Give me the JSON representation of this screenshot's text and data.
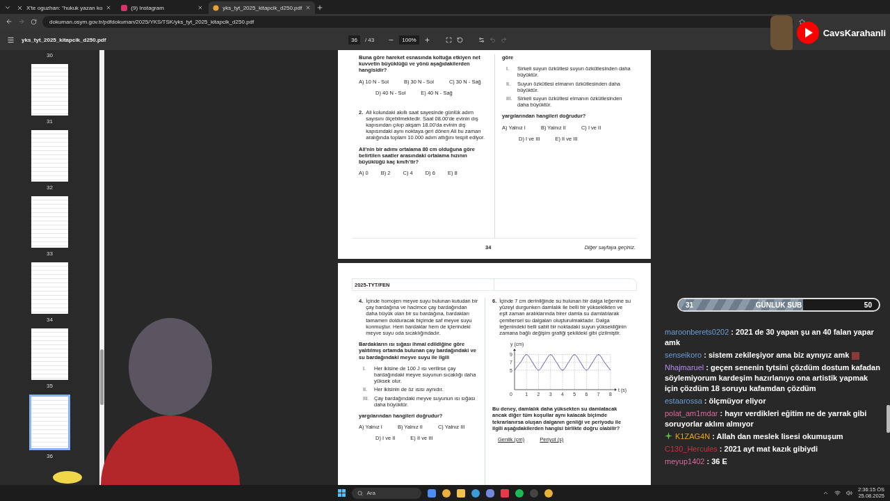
{
  "browser": {
    "tabs": [
      {
        "title": "X'te oguzhan: \"hukuk yazan ko",
        "kind": "x",
        "selected": false
      },
      {
        "title": "(9) Instagram",
        "kind": "instagram",
        "selected": false
      },
      {
        "title": "yks_tyt_2025_kitapcik_d250.pdf",
        "kind": "pdf",
        "selected": true
      }
    ],
    "url": "dokuman.osym.gov.tr/pdfdokuman/2025/YKS/TSK/yks_tyt_2025_kitapcik_d250.pdf"
  },
  "channel_logo": {
    "name": "CavsKarahanli"
  },
  "pdf_toolbar": {
    "title": "yks_tyt_2025_kitapcik_d250.pdf",
    "page": "36",
    "page_count": "/ 43",
    "zoom": "100%"
  },
  "thumbnails": {
    "top_label": "30",
    "items": [
      {
        "label": "31",
        "selected": false
      },
      {
        "label": "32",
        "selected": false
      },
      {
        "label": "33",
        "selected": false
      },
      {
        "label": "34",
        "selected": false
      },
      {
        "label": "35",
        "selected": false
      },
      {
        "label": "36",
        "selected": true
      }
    ]
  },
  "pages": [
    {
      "columns": [
        [
          {
            "kind": "bold",
            "text": "Buna göre hareket esnasında koltuğa etkiyen net kuvvetin büyüklüğü ve yönü aşağıdakilerden hangisidir?"
          },
          {
            "kind": "options",
            "rows": [
              [
                "A) 10 N - Sol",
                "B) 30 N - Sol",
                "C) 30 N - Sağ"
              ],
              [
                "D) 40 N - Sol",
                "E) 40 N - Sağ"
              ]
            ]
          },
          {
            "kind": "question",
            "number": "2.",
            "text": "Ali kolundaki akıllı saat sayesinde günlük adım sayısını ölçebilmektedir. Saat 08.00'de evinin dış kapısından çıkıp akşam 18.00'da evinin dış kapısındaki aynı noktaya geri dönen Ali bu zaman aralığında toplam 10.000 adım attığını tespit ediyor."
          },
          {
            "kind": "bold",
            "text": "Ali'nin bir adımı ortalama 80 cm olduğuna göre belirtilen saatler arasındaki ortalama hızının büyüklüğü kaç km/h'tir?"
          },
          {
            "kind": "options",
            "rows": [
              [
                "A) 0",
                "B) 2",
                "C) 4",
                "D) 6",
                "E) 8"
              ]
            ]
          }
        ],
        [
          {
            "kind": "bold",
            "text": "göre"
          },
          {
            "kind": "statements",
            "items": [
              {
                "numeral": "I.",
                "text": "Sirkeli suyun özkütlesi suyun özkütlesinden daha büyüktür."
              },
              {
                "numeral": "II.",
                "text": "Suyun özkütlesi elmanın özkütlesinden daha büyüktür."
              },
              {
                "numeral": "III.",
                "text": "Sirkeli suyun özkütlesi elmanın özkütlesinden daha büyüktür."
              }
            ]
          },
          {
            "kind": "bold",
            "text": "yargılarından hangileri doğrudur?"
          },
          {
            "kind": "options",
            "rows": [
              [
                "A) Yalnız I",
                "B) Yalnız II",
                "C) I ve II"
              ],
              [
                "D) I ve III",
                "E) II ve III"
              ]
            ]
          }
        ]
      ],
      "footer": {
        "page_number": "34",
        "note": "Diğer sayfaya geçiniz."
      }
    },
    {
      "header": "2025-TYT/FEN",
      "columns": [
        [
          {
            "kind": "question",
            "number": "4.",
            "text": "İçinde homojen meyve suyu bulunan kutudan bir çay bardağına ve hacimce çay bardağından daha büyük olan bir su bardağına, bardakları tamamen dolduracak biçimde saf meyve suyu konmuştur. Hem bardaklar hem de içlerindeki meyve suyu oda sıcaklığındadır."
          },
          {
            "kind": "bold",
            "text": "Bardakların ısı sığası ihmal edildiğine göre yalıtılmış ortamda bulunan çay bardağındaki ve su bardağındaki meyve suyu ile ilgili"
          },
          {
            "kind": "statements",
            "items": [
              {
                "numeral": "I.",
                "text": "Her ikisine de 100 J ısı verilirse çay bardağındaki meyve suyunun sıcaklığı daha yüksek olur."
              },
              {
                "numeral": "II.",
                "text": "Her ikisinin de öz ısısı aynıdır."
              },
              {
                "numeral": "III.",
                "text": "Çay bardağındaki meyve suyunun ısı sığası daha büyüktür."
              }
            ]
          },
          {
            "kind": "bold",
            "text": "yargılarından hangileri doğrudur?"
          },
          {
            "kind": "options",
            "rows": [
              [
                "A) Yalnız I",
                "B) Yalnız II",
                "C) Yalnız III"
              ],
              [
                "D) I ve II",
                "E) II ve III"
              ]
            ]
          }
        ],
        [
          {
            "kind": "question",
            "number": "6.",
            "text": "İçinde 7 cm derinliğinde su bulunan bir dalga leğenine su yüzeyi durgunken damlalık ile belli bir yükseklikten ve eşit zaman aralıklarında birer damla su damlatılarak çembersel su dalgaları oluşturulmaktadır. Dalga leğenindeki belli sabit bir noktadaki suyun yüksekliğinin zamana bağlı değişim grafiği şekildeki gibi çizilmiştir."
          },
          {
            "kind": "chart",
            "chart_data": {
              "type": "line",
              "xlabel": "t (s)",
              "ylabel": "y (cm)",
              "x": [
                0,
                0.5,
                1,
                1.5,
                2,
                2.5,
                3,
                3.5,
                4,
                4.5,
                5,
                5.5,
                6,
                6.5,
                7,
                7.5,
                8
              ],
              "series": [
                {
                  "color": "#5b4ea0",
                  "values": [
                    5,
                    7,
                    9,
                    7,
                    5,
                    7,
                    9,
                    7,
                    5,
                    7,
                    9,
                    7,
                    5,
                    7,
                    9,
                    7,
                    5
                  ]
                }
              ],
              "xlim": [
                0,
                8
              ],
              "ylim": [
                0,
                10
              ],
              "xticks": [
                0,
                1,
                2,
                3,
                4,
                5,
                6,
                7,
                8
              ],
              "yticks": [
                5,
                7,
                9
              ],
              "grid": true
            }
          },
          {
            "kind": "bold",
            "text": "Bu deney, damlalık daha yüksekten su damlatacak ancak diğer tüm koşullar aynı kalacak biçimde tekrarlanırsa oluşan dalganın genliği ve periyodu ile ilgili aşağıdakilerden hangisi birlikte doğru olabilir?"
          },
          {
            "kind": "table_head",
            "cells": [
              "Genlik (cm)",
              "Periyot (s)"
            ]
          }
        ]
      ]
    }
  ],
  "goal_bar": {
    "start": "31",
    "label": "GÜNLUK SUB",
    "end": "50",
    "level": 0.62
  },
  "chat": [
    {
      "user": "maroonberets0202",
      "color": "#6a9fd8",
      "badge": false,
      "emote": false,
      "text": ": 2021 de 30 yapan şu an 40 falan yapar amk"
    },
    {
      "user": "senseikoro",
      "color": "#6a9fd8",
      "badge": false,
      "emote": true,
      "text": ": sistem zekileşiyor ama biz aynıyız amk"
    },
    {
      "user": "Nhajmaruel",
      "color": "#b68cf0",
      "badge": false,
      "emote": false,
      "text": ": geçen senenin tytsini çözdüm dostum kafadan söylemiyorum kardeşim hazırlanıyo ona artistik yapmak için çözdüm 18 soruyu kafamdan çözdüm"
    },
    {
      "user": "estaarossa",
      "color": "#6a9fd8",
      "badge": false,
      "emote": false,
      "text": ": ölçmüyor eliyor"
    },
    {
      "user": "polat_am1mdar",
      "color": "#d86a9a",
      "badge": false,
      "emote": false,
      "text": ": hayır verdikleri eğitim ne de yarrak gibi soruyorlar aklım almıyor"
    },
    {
      "user": "K1ZAG4N",
      "color": "#f0a020",
      "badge": true,
      "emote": false,
      "text": ": Allah dan meslek lisesi okumuşum"
    },
    {
      "user": "C130_Hercules",
      "color": "#d0303f",
      "badge": false,
      "emote": false,
      "text": ": 2021 ayt mat kazık gibiydi"
    },
    {
      "user": "meyup1402",
      "color": "#d86a9a",
      "badge": false,
      "emote": false,
      "text": ": 36 E"
    }
  ],
  "taskbar": {
    "search_placeholder": "Ara",
    "time": "2:36:15 ÖS",
    "date": "25.08.2025"
  }
}
